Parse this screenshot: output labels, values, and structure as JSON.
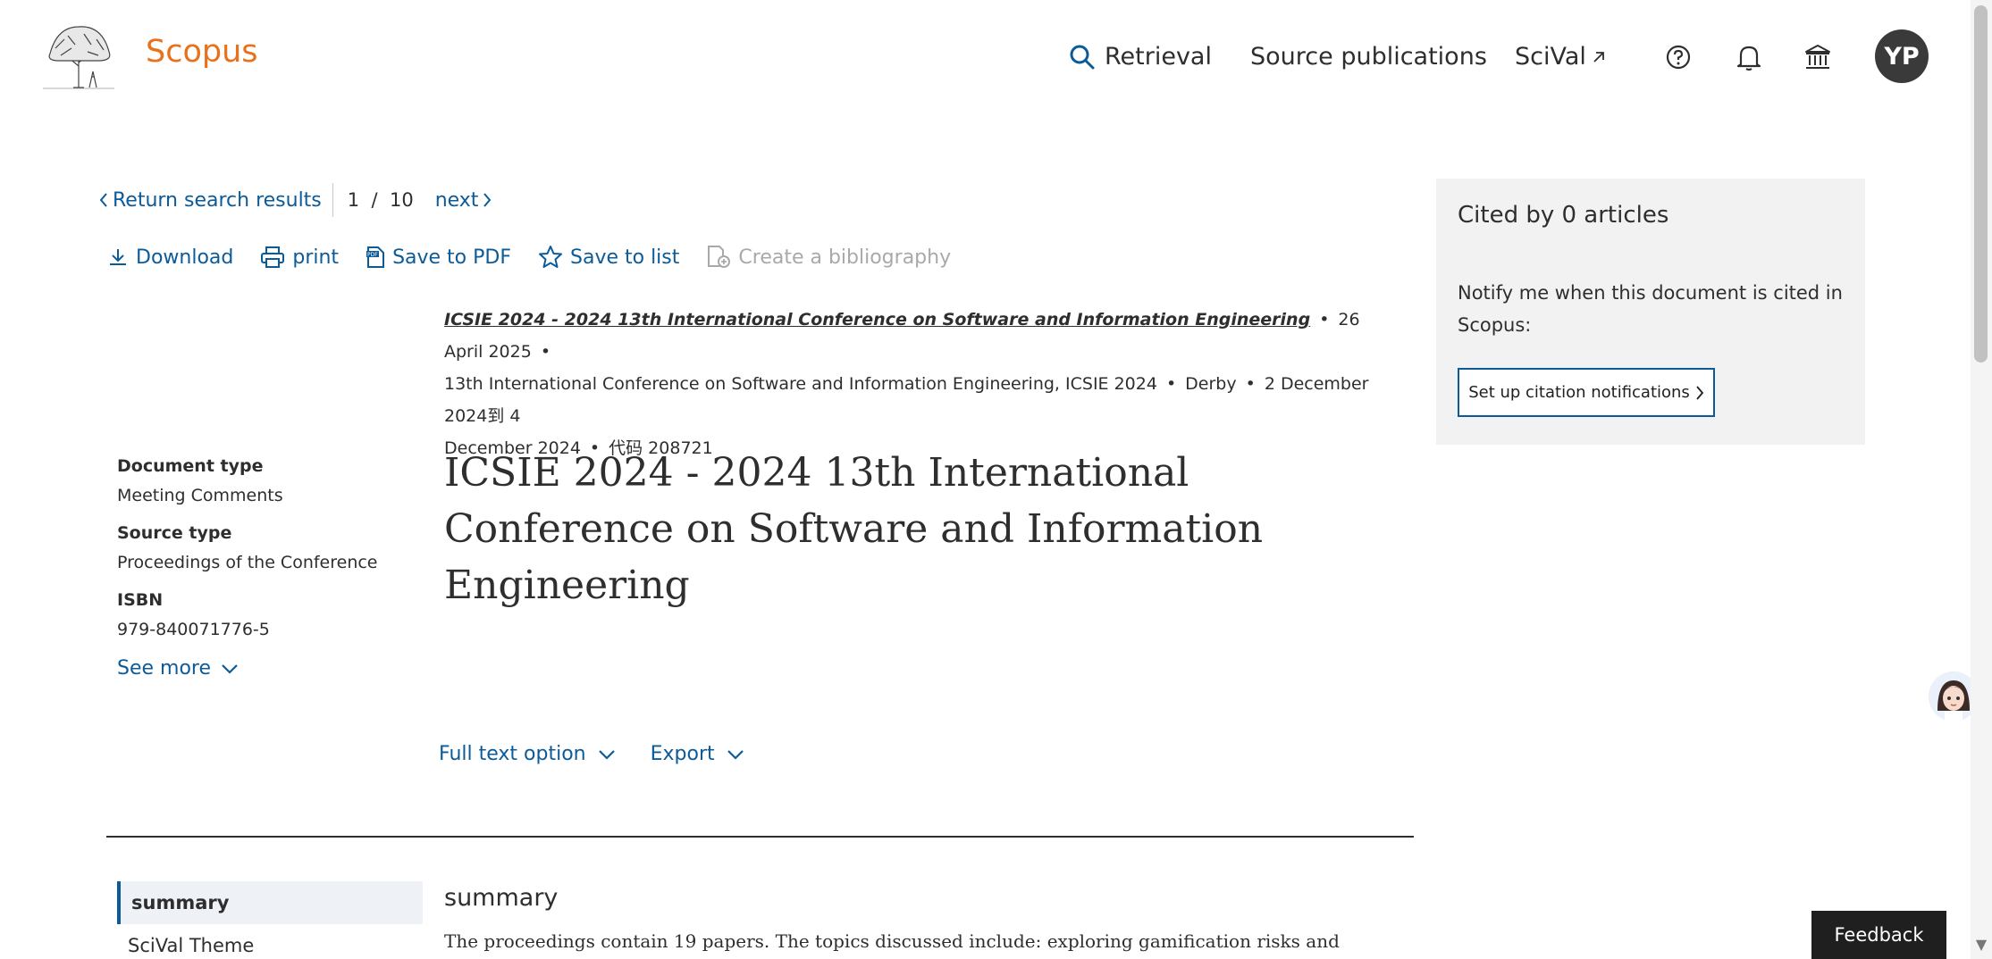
{
  "header": {
    "brand": "Scopus",
    "nav": {
      "retrieval": "Retrieval",
      "sources": "Source publications",
      "scival": "SciVal"
    },
    "avatar_initials": "YP"
  },
  "result_nav": {
    "return_label": "Return search results",
    "current": "1",
    "separator": "/",
    "total": "10",
    "next_label": "next"
  },
  "toolbar": {
    "download": "Download",
    "print": "print",
    "save_pdf": "Save to PDF",
    "save_list": "Save to list",
    "bibliography": "Create a bibliography"
  },
  "source": {
    "title": "ICSIE 2024 - 2024 13th International Conference on Software and Information Engineering",
    "date": "26 April 2025",
    "conference": "13th International Conference on Software and Information Engineering, ICSIE 2024",
    "location": "Derby",
    "dates_a": "2 December 2024到 4",
    "dates_b": "December 2024",
    "code": "代码 208721"
  },
  "metadata": {
    "doc_type_label": "Document type",
    "doc_type_value": "Meeting Comments",
    "source_type_label": "Source type",
    "source_type_value": "Proceedings of the Conference",
    "isbn_label": "ISBN",
    "isbn_value": "979-840071776-5",
    "see_more": "See more"
  },
  "document": {
    "title": "ICSIE 2024 - 2024 13th International Conference on Software and Information Engineering"
  },
  "options": {
    "full_text": "Full text option",
    "export": "Export"
  },
  "sections": {
    "active": "summary",
    "scival": "SciVal Theme"
  },
  "summary": {
    "heading": "summary",
    "text": "The proceedings contain 19 papers. The topics discussed include: exploring gamification risks and"
  },
  "citations": {
    "title": "Cited by 0 articles",
    "notify": "Notify me when this document is cited in Scopus:",
    "button": "Set up citation notifications"
  },
  "feedback": "Feedback",
  "colors": {
    "brand": "#e9711c",
    "link": "#0c5b99",
    "panel": "#f2f2f2"
  }
}
